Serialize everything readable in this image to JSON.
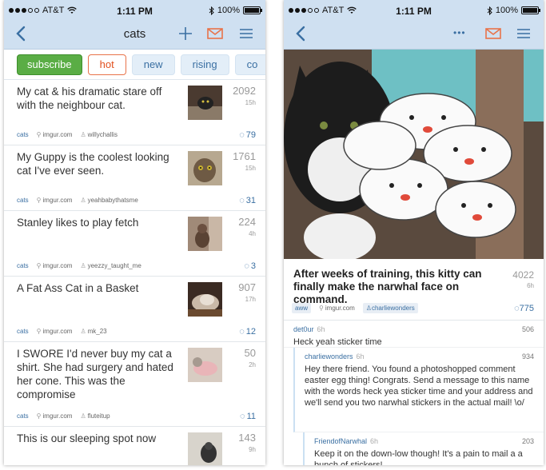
{
  "status": {
    "carrier": "AT&T",
    "time": "1:11 PM",
    "battery": "100%",
    "battery_level": 1.0
  },
  "left": {
    "nav_title": "cats",
    "tabs": [
      "subscribe",
      "hot",
      "new",
      "rising",
      "co"
    ],
    "posts": [
      {
        "title": "My cat & his dramatic stare off with the neighbour cat.",
        "score": "2092",
        "age": "15h",
        "sub": "cats",
        "domain": "imgur.com",
        "user": "willychallis",
        "comments": "79"
      },
      {
        "title": "My Guppy is the coolest looking cat I've ever seen.",
        "score": "1761",
        "age": "15h",
        "sub": "cats",
        "domain": "imgur.com",
        "user": "yeahbabythatsme",
        "comments": "31"
      },
      {
        "title": "Stanley likes to play fetch",
        "score": "224",
        "age": "4h",
        "sub": "cats",
        "domain": "imgur.com",
        "user": "yeezzy_taught_me",
        "comments": "3"
      },
      {
        "title": "A Fat Ass Cat in a Basket",
        "score": "907",
        "age": "17h",
        "sub": "cats",
        "domain": "imgur.com",
        "user": "mk_23",
        "comments": "12"
      },
      {
        "title": "I SWORE I'd never buy my cat a shirt. She had surgery and hated her cone. This was the compromise",
        "score": "50",
        "age": "2h",
        "sub": "cats",
        "domain": "imgur.com",
        "user": "fluteitup",
        "comments": "11"
      },
      {
        "title": "This is our sleeping spot now",
        "score": "143",
        "age": "9h"
      }
    ]
  },
  "right": {
    "nav_more": "•••",
    "post": {
      "title": "After weeks of training, this kitty can finally make the narwhal face on command.",
      "score": "4022",
      "age": "6h",
      "sub": "aww",
      "domain": "imgur.com",
      "user": "charliewonders",
      "comments": "775"
    },
    "comments": [
      {
        "author": "det0ur",
        "age": "6h",
        "points": "506",
        "body": "Heck yeah sticker time"
      },
      {
        "author": "charliewonders",
        "age": "6h",
        "points": "934",
        "body": "Hey there friend. You found a photoshopped comment easter egg thing! Congrats. Send a message to this name with the words heck yea sticker time and your address and we'll send you two narwhal stickers in the actual mail! \\o/"
      },
      {
        "author": "FriendofNarwhal",
        "age": "6h",
        "points": "203",
        "body": "Keep it on the down-low though! It's a pain to mail a a bunch of stickers!"
      }
    ]
  },
  "icons": {
    "back": "chevron-left-icon",
    "add": "plus-icon",
    "mail": "envelope-icon",
    "menu": "hamburger-icon",
    "wifi": "wifi-icon",
    "bluetooth": "bluetooth-icon",
    "link": "link-icon",
    "user": "user-icon",
    "comment": "comment-bubble-icon"
  },
  "colors": {
    "nav_bg": "#cfe0f1",
    "accent_blue": "#3a6fa2",
    "subscribe_green": "#5aad45",
    "hot_orange": "#e14f1d",
    "mail_orange": "#e8734a"
  }
}
